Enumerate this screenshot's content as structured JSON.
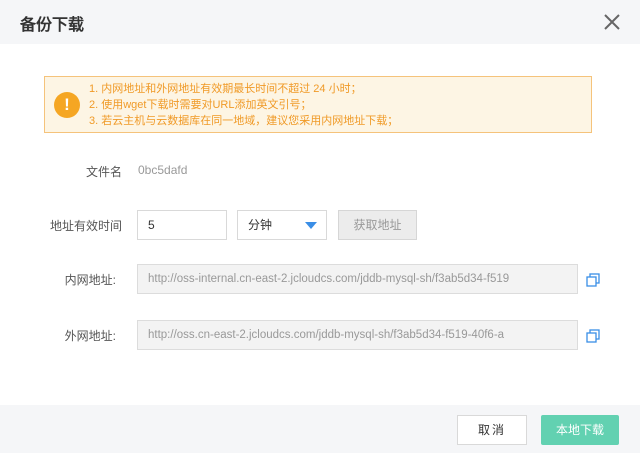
{
  "dialog": {
    "title": "备份下载",
    "close_icon": "close-icon"
  },
  "alert": {
    "icon": "warning-icon",
    "icon_glyph": "!",
    "lines": [
      "1. 内网地址和外网地址有效期最长时间不超过 24 小时；",
      "2. 使用wget下载时需要对URL添加英文引号；",
      "3. 若云主机与云数据库在同一地域，建议您采用内网地址下载；"
    ]
  },
  "form": {
    "filename_label": "文件名",
    "filename_value": "0bc5dafd",
    "validity_label": "地址有效时间",
    "validity_value": "5",
    "unit_selected": "分钟",
    "get_address_button": "获取地址",
    "internal_label": "内网地址:",
    "internal_url": "http://oss-internal.cn-east-2.jcloudcs.com/jddb-mysql-sh/f3ab5d34-f519",
    "external_label": "外网地址:",
    "external_url": "http://oss.cn-east-2.jcloudcs.com/jddb-mysql-sh/f3ab5d34-f519-40f6-a"
  },
  "footer": {
    "cancel_label": "取消",
    "download_label": "本地下载"
  },
  "colors": {
    "primary": "#62d1b1",
    "warning": "#f5a623",
    "warning_text": "#f09a27",
    "select_arrow": "#3a8ee6",
    "copy_icon": "#3a8ee6"
  }
}
